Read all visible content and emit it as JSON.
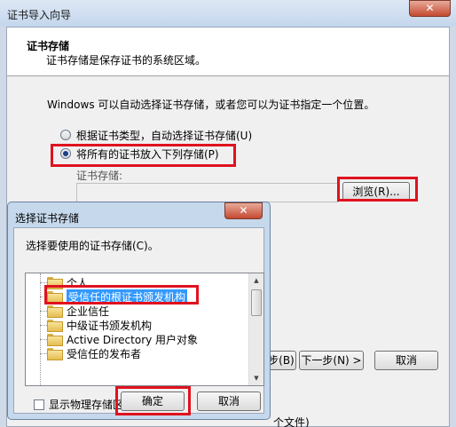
{
  "wizard": {
    "title": "证书导入向导",
    "close": "✕",
    "header_title": "证书存储",
    "header_desc": "证书存储是保存证书的系统区域。",
    "intro": "Windows 可以自动选择证书存储，或者您可以为证书指定一个位置。",
    "radio_auto": "根据证书类型，自动选择证书存储(U)",
    "radio_manual": "将所有的证书放入下列存储(P)",
    "store_label": "证书存储:",
    "store_value": "",
    "browse_button": "浏览(R)...",
    "back_button": "< 上一步(B)",
    "next_button": "下一步(N) >",
    "cancel_button": "取消",
    "statusbar_fragment": "个文件)"
  },
  "dialog": {
    "title": "选择证书存储",
    "close": "✕",
    "prompt": "选择要使用的证书存储(C)。",
    "stores": [
      {
        "label": "个人",
        "selected": false
      },
      {
        "label": "受信任的根证书颁发机构",
        "selected": true
      },
      {
        "label": "企业信任",
        "selected": false
      },
      {
        "label": "中级证书颁发机构",
        "selected": false
      },
      {
        "label": "Active Directory 用户对象",
        "selected": false
      },
      {
        "label": "受信任的发布者",
        "selected": false
      }
    ],
    "show_physical": "显示物理存储区(S)",
    "ok_button": "确定",
    "cancel_button": "取消"
  },
  "colors": {
    "highlight_box": "#e0121f",
    "selection": "#3399ff"
  }
}
